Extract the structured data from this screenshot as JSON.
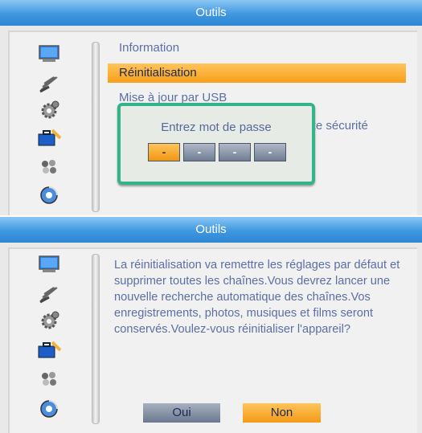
{
  "top_screen": {
    "title": "Outils",
    "menu_items": [
      {
        "label": "Information",
        "selected": false
      },
      {
        "label": "Réinitialisation",
        "selected": true
      },
      {
        "label": "Mise à jour par USB",
        "selected": false
      },
      {
        "label": "oute sécurité",
        "selected": false
      }
    ],
    "password_dialog": {
      "title": "Entrez mot de passe",
      "digits": [
        "-",
        "-",
        "-",
        "-"
      ]
    }
  },
  "bottom_screen": {
    "title": "Outils",
    "message": "La réinitialisation va remettre les réglages par défaut et supprimer toutes les chaînes.Vous devrez lancer une nouvelle recherche automatique des chaînes.Vos enregistrements, photos, musiques et films seront conservés.Voulez-vous réinitialiser l'appareil?",
    "buttons": {
      "yes": "Oui",
      "no": "Non"
    }
  },
  "sidebar_icons": [
    "tv-screen-icon",
    "satellite-dish-icon",
    "gear-icon",
    "toolbox-icon",
    "game-icon",
    "media-disc-icon"
  ],
  "colors": {
    "title_bar": "#3e97e0",
    "highlight": "#f7a01a",
    "dialog_border": "#33b38a",
    "text": "#5a6fa3"
  }
}
